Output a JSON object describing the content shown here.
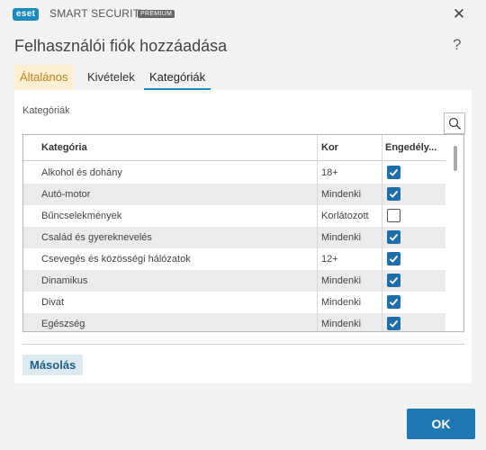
{
  "titlebar": {
    "logo": "eset",
    "brand": "SMART SECURITY",
    "edition": "PREMIUM",
    "close_glyph": "✕"
  },
  "dialog": {
    "title": "Felhasználói fiók hozzáadása",
    "help_glyph": "?"
  },
  "tabs": [
    {
      "label": "Általános",
      "active": false
    },
    {
      "label": "Kivételek",
      "active": false
    },
    {
      "label": "Kategóriák",
      "active": true
    }
  ],
  "section": {
    "label": "Kategóriák",
    "search_icon": "search-icon"
  },
  "table": {
    "columns": [
      "Kategória",
      "Kor",
      "Engedély..."
    ],
    "rows": [
      {
        "name": "Alkohol és dohány",
        "age": "18+",
        "allowed": true
      },
      {
        "name": "Autó-motor",
        "age": "Mindenki",
        "allowed": true
      },
      {
        "name": "Bűncselekmények",
        "age": "Korlátozott",
        "allowed": false
      },
      {
        "name": "Család és gyereknevelés",
        "age": "Mindenki",
        "allowed": true
      },
      {
        "name": "Csevegés és közösségi hálózatok",
        "age": "12+",
        "allowed": true
      },
      {
        "name": "Dinamikus",
        "age": "Mindenki",
        "allowed": true
      },
      {
        "name": "Divat",
        "age": "Mindenki",
        "allowed": true
      },
      {
        "name": "Egészség",
        "age": "Mindenki",
        "allowed": true
      }
    ]
  },
  "buttons": {
    "copy": "Másolás",
    "ok": "OK"
  },
  "colors": {
    "accent": "#1f77b4",
    "checkbox": "#1f6fa8",
    "active_tab_bg": "#fcefd2",
    "active_tab_text": "#c0801e"
  }
}
